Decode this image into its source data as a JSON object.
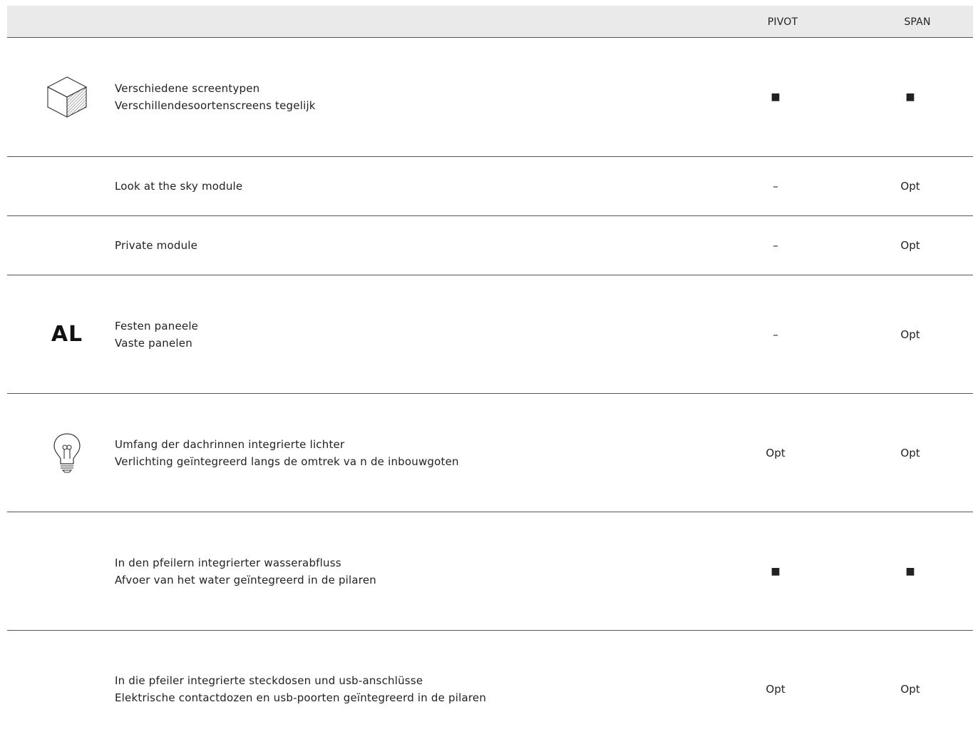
{
  "header": {
    "col_pivot": "PIVOT",
    "col_span": "SPAN"
  },
  "rows": [
    {
      "icon": "cube-icon",
      "line1": "Verschiedene screentypen",
      "line2": "Verschillendesoortenscreens tegelijk",
      "pivot": "■",
      "span": "■"
    },
    {
      "line1": "Look at the sky module",
      "pivot": "–",
      "span": "Opt"
    },
    {
      "line1": "Private module",
      "pivot": "–",
      "span": "Opt"
    },
    {
      "icon": "al-logo",
      "icon_text": "AL",
      "line1": "Festen paneele",
      "line2": "Vaste panelen",
      "pivot": "–",
      "span": "Opt"
    },
    {
      "icon": "lightbulb-icon",
      "line1": "Umfang der dachrinnen integrierte lichter",
      "line2": "Verlichting geïntegreerd langs de omtrek va n de inbouwgoten",
      "pivot": "Opt",
      "span": "Opt"
    },
    {
      "line1": "In den pfeilern integrierter wasserabfluss",
      "line2": "Afvoer van het water geïntegreerd in de pilaren",
      "pivot": "■",
      "span": "■"
    },
    {
      "line1": "In die pfeiler integrierte steckdosen und usb-anschlüsse",
      "line2": "Elektrische contactdozen en usb-poorten geïntegreerd in de pilaren",
      "pivot": "Opt",
      "span": "Opt"
    }
  ]
}
